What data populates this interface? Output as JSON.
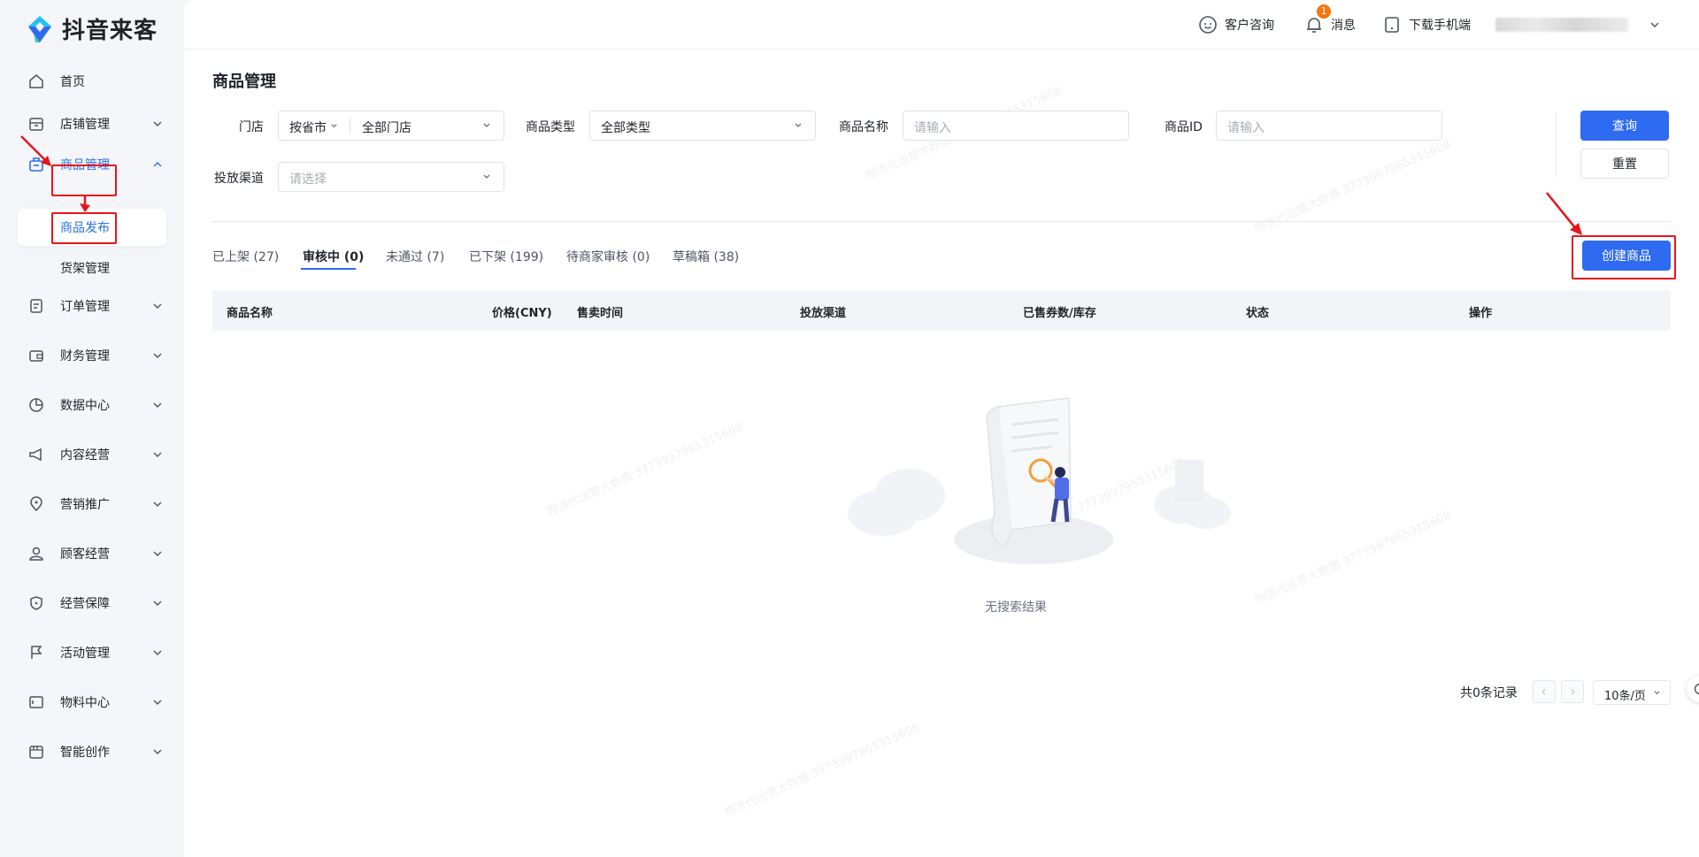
{
  "brand": {
    "name": "抖音来客"
  },
  "sidebar": {
    "items": [
      {
        "label": "首页",
        "icon": "home-icon"
      },
      {
        "label": "店铺管理",
        "icon": "store-icon"
      },
      {
        "label": "商品管理",
        "icon": "product-icon",
        "expanded": true
      },
      {
        "label": "订单管理",
        "icon": "order-icon"
      },
      {
        "label": "财务管理",
        "icon": "wallet-icon"
      },
      {
        "label": "数据中心",
        "icon": "chart-pie-icon"
      },
      {
        "label": "内容经营",
        "icon": "megaphone-icon"
      },
      {
        "label": "营销推广",
        "icon": "location-icon"
      },
      {
        "label": "顾客经营",
        "icon": "user-icon"
      },
      {
        "label": "经营保障",
        "icon": "shield-icon"
      },
      {
        "label": "活动管理",
        "icon": "flag-icon"
      },
      {
        "label": "物料中心",
        "icon": "material-icon"
      },
      {
        "label": "智能创作",
        "icon": "clapper-icon"
      }
    ],
    "sub_items": [
      {
        "label": "商品发布",
        "selected": true
      },
      {
        "label": "货架管理",
        "selected": false
      }
    ]
  },
  "topbar": {
    "consult": "客户咨询",
    "messages": "消息",
    "message_badge": "1",
    "download": "下载手机端"
  },
  "page": {
    "title": "商品管理"
  },
  "filters": {
    "store_label": "门店",
    "store_region": "按省市",
    "store_value": "全部门店",
    "type_label": "商品类型",
    "type_value": "全部类型",
    "name_label": "商品名称",
    "name_placeholder": "请输入",
    "id_label": "商品ID",
    "id_placeholder": "请输入",
    "channel_label": "投放渠道",
    "channel_placeholder": "请选择",
    "query_button": "查询",
    "reset_button": "重置"
  },
  "create_button": "创建商品",
  "tabs": [
    {
      "label": "已上架 (27)",
      "active": false
    },
    {
      "label": "审核中 (0)",
      "active": true
    },
    {
      "label": "未通过 (7)",
      "active": false
    },
    {
      "label": "已下架 (199)",
      "active": false
    },
    {
      "label": "待商家审核 (0)",
      "active": false
    },
    {
      "label": "草稿箱 (38)",
      "active": false
    }
  ],
  "table": {
    "columns": [
      "商品名称",
      "价格(CNY)",
      "售卖时间",
      "投放渠道",
      "已售券数/库存",
      "状态",
      "操作"
    ]
  },
  "empty_text": "无搜索结果",
  "pagination": {
    "total": "共0条记录",
    "page_size": "10条/页"
  },
  "colors": {
    "primary": "#2f6bf0",
    "active_nav": "#2a6fe8",
    "annotation": "#e8141b",
    "badge": "#f7740e"
  }
}
